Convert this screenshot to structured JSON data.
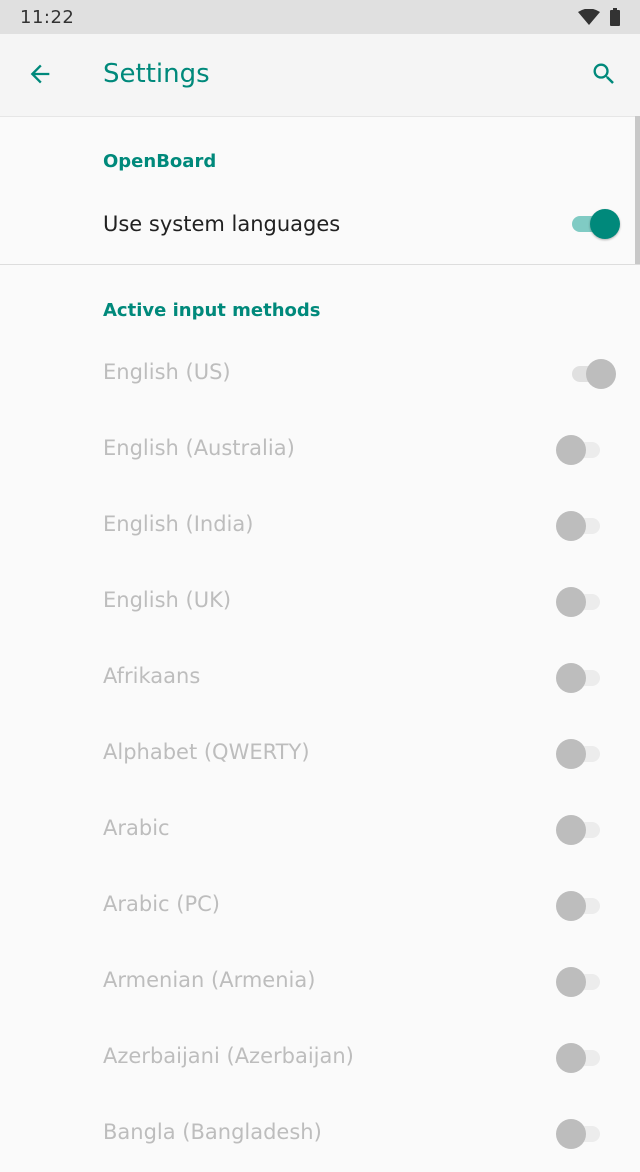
{
  "status_bar": {
    "time": "11:22"
  },
  "app_bar": {
    "title": "Settings"
  },
  "sections": {
    "openboard": {
      "header": "OpenBoard",
      "use_system_languages": {
        "label": "Use system languages",
        "on": true
      }
    },
    "active_input_methods": {
      "header": "Active input methods"
    }
  },
  "languages": [
    {
      "label": "English (US)",
      "on": true
    },
    {
      "label": "English (Australia)",
      "on": false
    },
    {
      "label": "English (India)",
      "on": false
    },
    {
      "label": "English (UK)",
      "on": false
    },
    {
      "label": "Afrikaans",
      "on": false
    },
    {
      "label": "Alphabet (QWERTY)",
      "on": false
    },
    {
      "label": "Arabic",
      "on": false
    },
    {
      "label": "Arabic (PC)",
      "on": false
    },
    {
      "label": "Armenian (Armenia)",
      "on": false
    },
    {
      "label": "Azerbaijani (Azerbaijan)",
      "on": false
    },
    {
      "label": "Bangla (Bangladesh)",
      "on": false
    }
  ],
  "colors": {
    "accent": "#00897b",
    "disabled_text": "#bdbdbd"
  }
}
